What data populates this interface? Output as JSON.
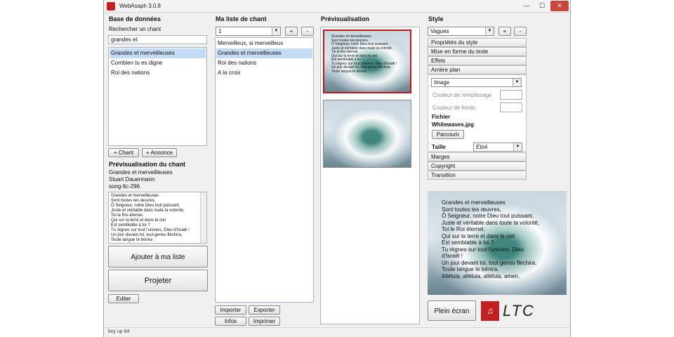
{
  "window": {
    "title": "WebAsaph 3.0.8",
    "controls": {
      "minimize": "—",
      "maximize": "☐",
      "close": "✕"
    },
    "status": "key up 84"
  },
  "database": {
    "heading": "Base de données",
    "search_label": "Rechercher un chant",
    "search_value": "grandes et",
    "results": [
      "Grandes et merveilleuses",
      "Combien tu es digne",
      "Roi des nations"
    ],
    "selected_index": 0,
    "add_song_label": "+ Chant",
    "add_announce_label": "+ Annonce"
  },
  "song_preview": {
    "heading": "Prévisualisation du chant",
    "title": "Grandes et merveilleuses",
    "author": "Stuart Dauermann",
    "id": "song-ltc-296",
    "lyrics": "Grandes et merveilleuses\nSont toutes tes œuvres,\nÔ Seigneur, notre Dieu tout puissant,\nJuste et véritable dans toute ta volonté,\nToi le Roi éternel.\nQui sur la terre et dans le ciel\nEst semblable à toi ?\nTu règnes sur tout l'univers, Dieu d'Israël !\nUn jour devant toi, tout genou fléchira,\nToute langue te bénira",
    "add_to_list_label": "Ajouter à ma liste",
    "project_label": "Projeter",
    "edit_label": "Editer"
  },
  "playlist": {
    "heading": "Ma liste de chant",
    "selected_list": "1",
    "add_label": "+",
    "remove_label": "-",
    "items": [
      "Merveilleux, si merveilleux",
      "Grandes et merveilleuses",
      "Roi des nations",
      "A la croix"
    ],
    "selected_index": 1,
    "import_label": "Importer",
    "export_label": "Exporter",
    "info_label": "Infos",
    "print_label": "Imprimer"
  },
  "preview": {
    "heading": "Prévisualisation"
  },
  "style": {
    "heading": "Style",
    "selected_style": "Vagues",
    "add_label": "+",
    "remove_label": "-",
    "sections": {
      "properties": "Propriétés du style",
      "text_format": "Mise en forme du texte",
      "effects": "Effets",
      "background": "Arrière plan",
      "margins": "Marges",
      "copyright": "Copyright",
      "transition": "Transition"
    },
    "background_type": "Image",
    "fill_color_label": "Couleur de remplissage",
    "blend_color_label": "Couleur de fondu",
    "file_label": "Fichier",
    "file_name": "Whitewaves.jpg",
    "browse_label": "Parcourir",
    "size_label": "Taille",
    "size_value": "Etiré"
  },
  "live": {
    "lyrics": "Grandes et merveilleuses\nSont toutes tes œuvres,\nÔ Seigneur, notre Dieu tout puissant,\nJuste et véritable dans toute ta volonté,\nToi le Roi éternel.\nQui sur la terre et dans le ciel\nEst semblable à toi ?\nTu règnes sur tout l'univers, Dieu\nd'Israël !\nUn jour devant toi, tout genou fléchira,\nToute langue te bénira.\nAlléluia, alléluia, alléluia, amen.",
    "fullscreen_label": "Plein écran",
    "logo_text": "LTC"
  },
  "colors": {
    "selection": "#c4dbf5",
    "accent_red": "#c42020",
    "preview_border": "#c0141e"
  }
}
